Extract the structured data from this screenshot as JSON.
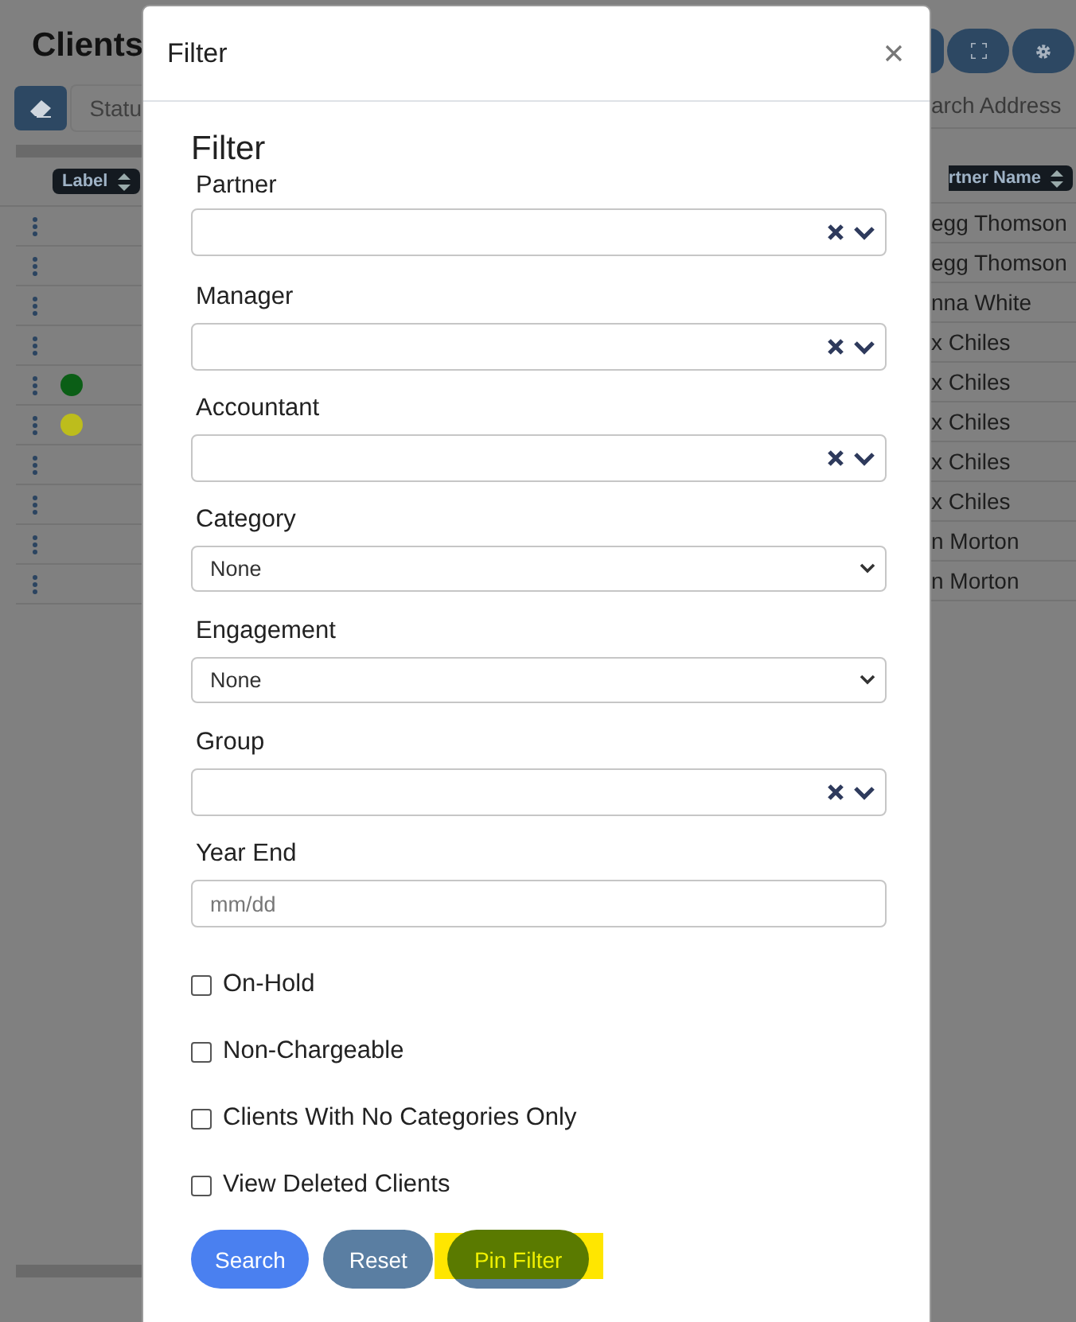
{
  "page": {
    "title": "Clients",
    "status_field": "Statu",
    "search_field": "arch Address"
  },
  "table": {
    "columns": [
      {
        "label": "Label"
      },
      {
        "label": "rtner Name"
      }
    ],
    "rows": [
      {
        "partner": "egg Thomson"
      },
      {
        "partner": "egg Thomson"
      },
      {
        "partner": "nna White"
      },
      {
        "partner": "x Chiles"
      },
      {
        "color": "#0b5e16",
        "partner": "x Chiles"
      },
      {
        "color": "#bdbd1c",
        "partner": "x Chiles"
      },
      {
        "partner": "x Chiles"
      },
      {
        "partner": "x Chiles"
      },
      {
        "partner": "n Morton"
      },
      {
        "partner": "n Morton"
      }
    ]
  },
  "modal": {
    "title": "Filter",
    "heading": "Filter",
    "fields": [
      {
        "kind": "select2",
        "label": "Partner"
      },
      {
        "kind": "select2",
        "label": "Manager"
      },
      {
        "kind": "select2",
        "label": "Accountant"
      },
      {
        "kind": "select",
        "label": "Category",
        "value": "None"
      },
      {
        "kind": "select",
        "label": "Engagement",
        "value": "None"
      },
      {
        "kind": "select2",
        "label": "Group"
      },
      {
        "kind": "date",
        "label": "Year End",
        "placeholder": "mm/dd"
      }
    ],
    "checkboxes": [
      {
        "label": "On-Hold",
        "checked": false
      },
      {
        "label": "Non-Chargeable",
        "checked": false
      },
      {
        "label": "Clients With No Categories Only",
        "checked": false
      },
      {
        "label": "View Deleted Clients",
        "checked": false
      }
    ],
    "buttons": [
      {
        "label": "Search",
        "kind": "primary",
        "highlighted": false
      },
      {
        "label": "Reset",
        "kind": "secondary",
        "highlighted": false
      },
      {
        "label": "Pin Filter",
        "kind": "secondary",
        "highlighted": true
      }
    ]
  }
}
